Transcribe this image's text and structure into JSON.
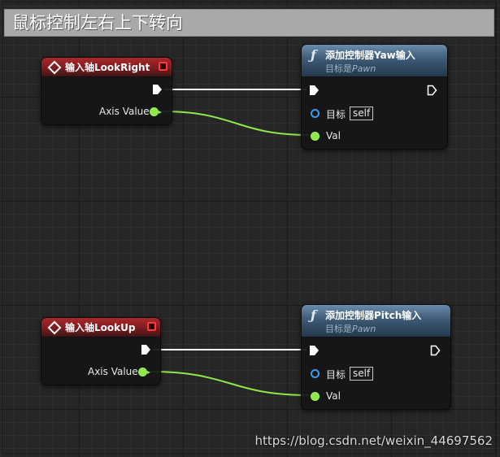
{
  "comment": {
    "title": "鼠标控制左右上下转向"
  },
  "nodes": {
    "look_right_event": {
      "title": "输入轴LookRight",
      "axis_label": "Axis Value"
    },
    "add_yaw": {
      "title": "添加控制器Yaw输入",
      "target_prefix": "目标是",
      "target_class": "Pawn",
      "target_label": "目标",
      "target_value": "self",
      "val_label": "Val"
    },
    "look_up_event": {
      "title": "输入轴LookUp",
      "axis_label": "Axis Value"
    },
    "add_pitch": {
      "title": "添加控制器Pitch输入",
      "target_prefix": "目标是",
      "target_class": "Pawn",
      "target_label": "目标",
      "target_value": "self",
      "val_label": "Val"
    }
  },
  "icons": {
    "event": "diamond-event-icon",
    "function": "function-f-icon",
    "delegate": "delegate-pin-icon",
    "exec": "exec-pin-icon"
  },
  "colors": {
    "event_header": "#a8292c",
    "function_header": "#3d5a76",
    "exec_wire": "#ffffff",
    "float_wire": "#8fe84a",
    "object_pin": "#3a9cf4"
  },
  "watermark": "https://blog.csdn.net/weixin_44697562"
}
